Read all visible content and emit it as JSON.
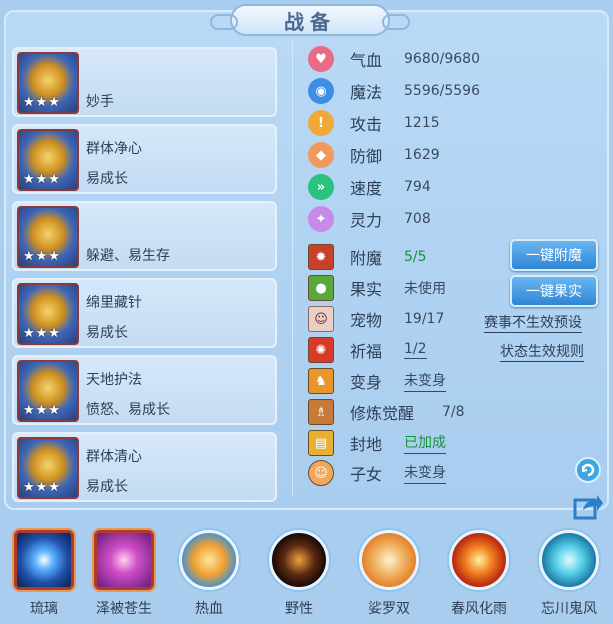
{
  "title": "战备",
  "equipment": [
    {
      "line1": "",
      "line2": "妙手",
      "stars": "★★★"
    },
    {
      "line1": "群体净心",
      "line2": "易成长",
      "stars": "★★★"
    },
    {
      "line1": "",
      "line2": "躲避、易生存",
      "stars": "★★★"
    },
    {
      "line1": "绵里藏针",
      "line2": "易成长",
      "stars": "★★★"
    },
    {
      "line1": "天地护法",
      "line2": "愤怒、易成长",
      "stars": "★★★"
    },
    {
      "line1": "群体清心",
      "line2": "易成长",
      "stars": "★★★"
    }
  ],
  "stats": [
    {
      "label": "气血",
      "value": "9680/9680",
      "icon": "heart-icon",
      "color": "#ea6b86",
      "glyph": "♥"
    },
    {
      "label": "魔法",
      "value": "5596/5596",
      "icon": "mana-icon",
      "color": "#3f8ee6",
      "glyph": "◉"
    },
    {
      "label": "攻击",
      "value": "1215",
      "icon": "sword-icon",
      "color": "#f0a838",
      "glyph": "!"
    },
    {
      "label": "防御",
      "value": "1629",
      "icon": "shield-icon",
      "color": "#f09a5e",
      "glyph": "◆"
    },
    {
      "label": "速度",
      "value": "794",
      "icon": "speed-icon",
      "color": "#2cc27e",
      "glyph": "»"
    },
    {
      "label": "灵力",
      "value": "708",
      "icon": "spirit-icon",
      "color": "#c88ae8",
      "glyph": "✦"
    }
  ],
  "rows": {
    "fumo": {
      "label": "附魔",
      "value": "5/5"
    },
    "guoshi": {
      "label": "果实",
      "value": "未使用"
    },
    "chongwu": {
      "label": "宠物",
      "value": "19/17"
    },
    "qifu": {
      "label": "祈福",
      "value": "1/2"
    },
    "bianshen": {
      "label": "变身",
      "value": "未变身"
    },
    "xiulian": {
      "label": "修炼觉醒",
      "value": "7/8"
    },
    "fengdi": {
      "label": "封地",
      "value": "已加成"
    },
    "zinv": {
      "label": "子女",
      "value": "未变身"
    }
  },
  "buttons": {
    "fumo": "一键附魔",
    "guoshi": "一键果实"
  },
  "links": {
    "preset": "赛事不生效预设",
    "rules": "状态生效规则"
  },
  "skills": [
    {
      "name": "琉璃",
      "color": "#3a8fe8"
    },
    {
      "name": "泽被苍生",
      "color": "#c24fd0"
    },
    {
      "name": "热血",
      "color": "#f0b040"
    },
    {
      "name": "野性",
      "color": "#4a2a1a"
    },
    {
      "name": "娑罗双",
      "color": "#e89a40"
    },
    {
      "name": "春风化雨",
      "color": "#e05a20"
    },
    {
      "name": "忘川鬼风",
      "color": "#4ab8d8"
    }
  ]
}
